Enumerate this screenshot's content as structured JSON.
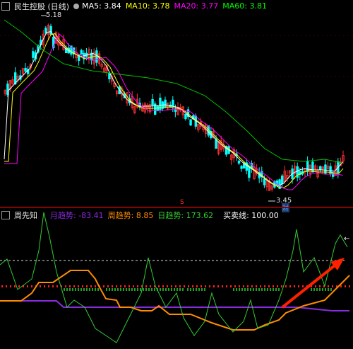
{
  "main": {
    "title": "民生控股 (日线)",
    "legend": [
      {
        "label": "MA5: 3.84",
        "color": "#ffffff"
      },
      {
        "label": "MA10: 3.78",
        "color": "#ffff00"
      },
      {
        "label": "MA20: 3.77",
        "color": "#ff00ff"
      },
      {
        "label": "MA60: 3.81",
        "color": "#00ff00"
      }
    ],
    "high_label": "5.18",
    "low_label": "3.45",
    "marker_cai": "财",
    "marker_s": "S"
  },
  "sub": {
    "title": "周先知",
    "legend": [
      {
        "label": "月趋势: -83.41",
        "color": "#8a2be2"
      },
      {
        "label": "周趋势: 8.85",
        "color": "#ff8c00"
      },
      {
        "label": "日趋势: 173.62",
        "color": "#00ff00"
      },
      {
        "label": "买卖线: 100.00",
        "color": "#ffffff"
      }
    ],
    "right_marker": "←"
  },
  "colors": {
    "up": "#ff3030",
    "down": "#00ffff",
    "ma5": "#ffffff",
    "ma10": "#ffff00",
    "ma20": "#ff00ff",
    "ma60": "#00c000",
    "month": "#8a2be2",
    "week": "#ff8c00",
    "day": "#33cc33",
    "arrow": "#ff2000"
  }
}
